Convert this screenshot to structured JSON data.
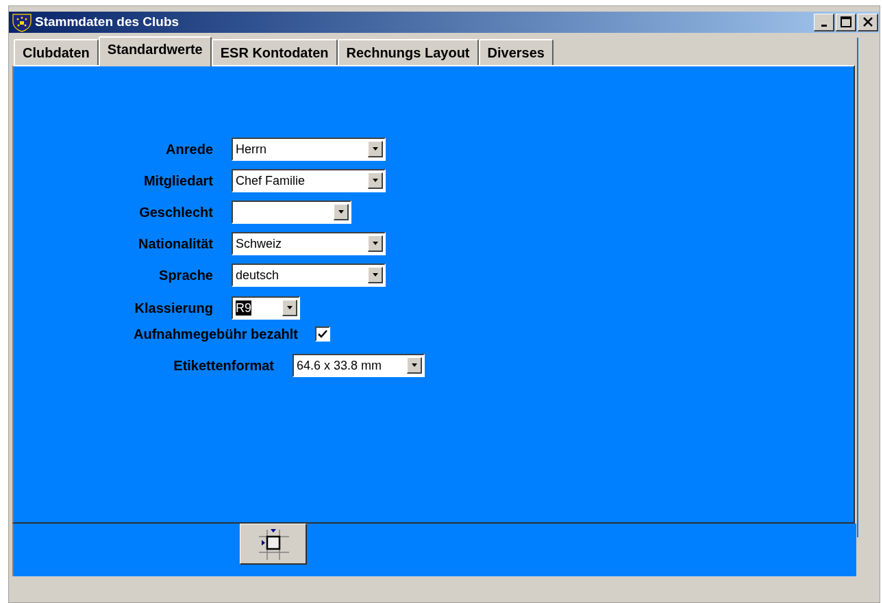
{
  "window": {
    "title": "Stammdaten des Clubs"
  },
  "tabs": [
    {
      "label": "Clubdaten",
      "selected": false
    },
    {
      "label": "Standardwerte",
      "selected": true
    },
    {
      "label": "ESR Kontodaten",
      "selected": false
    },
    {
      "label": "Rechnungs Layout",
      "selected": false
    },
    {
      "label": "Diverses",
      "selected": false
    }
  ],
  "fields": [
    {
      "kind": "dropdown",
      "label": "Anrede",
      "value": "Herrn"
    },
    {
      "kind": "dropdown",
      "label": "Mitgliedart",
      "value": "Chef Familie"
    },
    {
      "kind": "dropdown",
      "label": "Geschlecht"
    },
    {
      "kind": "dropdown",
      "label": "Nationalität",
      "value": "Schweiz"
    },
    {
      "kind": "dropdown",
      "label": "Sprache",
      "value": "deutsch"
    },
    {
      "kind": "dropdown",
      "label": "Klassierung",
      "value": "R9",
      "highlighted": true
    },
    {
      "kind": "checkbox",
      "label": "Aufnahmegebühr bezahlt",
      "checked": true
    },
    {
      "kind": "dropdown",
      "label": "Etikettenformat",
      "value": "64.6 x 33.8 mm"
    }
  ]
}
